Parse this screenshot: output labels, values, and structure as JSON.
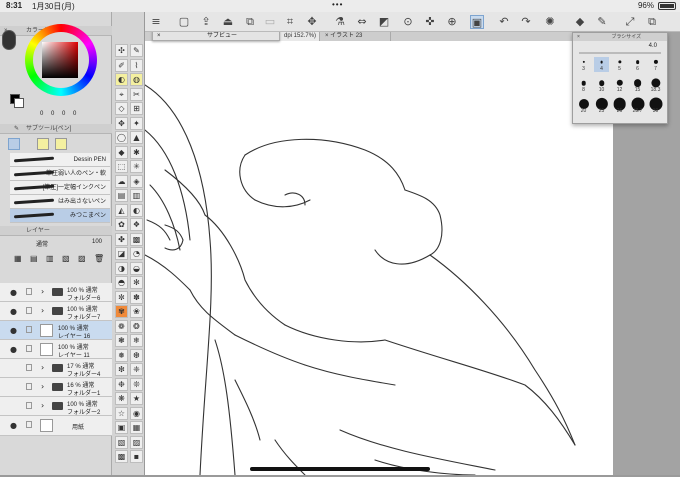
{
  "status_bar": {
    "time": "8:31",
    "date": "1月30日(月)",
    "dots": "•••",
    "battery": "96%"
  },
  "colors": {
    "accent": "#7ea4cf",
    "selected_row": "#c9dbef",
    "panel_bg": "#d9d9d9",
    "canvas_bg": "#ffffff"
  },
  "color_panel": {
    "title": "カラーサークル",
    "values": "0  0  0  0"
  },
  "subtool_panel": {
    "title": "サブツール[ペン]",
    "items": [
      {
        "label": "Dessin PEN"
      },
      {
        "label": "筆圧弱い人のペン・軟"
      },
      {
        "label": "[筆圧]一定幅インクペン"
      },
      {
        "label": "はみ出さないペン"
      },
      {
        "label": "みつこまペン"
      }
    ]
  },
  "layer_panel": {
    "title": "レイヤー",
    "blend_mode": "通常",
    "opacity": "100",
    "layers": [
      {
        "line1": "100 %  通常",
        "line2": "フォルダー6",
        "type": "folder"
      },
      {
        "line1": "100 %  通常",
        "line2": "フォルダー7",
        "type": "folder"
      },
      {
        "line1": "100 %  通常",
        "line2": "レイヤー 16",
        "type": "raster"
      },
      {
        "line1": "100 %  通常",
        "line2": "レイヤー 11",
        "type": "raster"
      },
      {
        "line1": "17 %  通常",
        "line2": "フォルダー4",
        "type": "folder"
      },
      {
        "line1": "16 %  通常",
        "line2": "フォルダー1",
        "type": "folder"
      },
      {
        "line1": "100 %  通常",
        "line2": "フォルダー2",
        "type": "folder"
      },
      {
        "line1": "",
        "line2": "用紙",
        "type": "paper"
      }
    ]
  },
  "canvas_tabs": [
    {
      "label": "dpi 152.7%)"
    },
    {
      "label": "イラスト 23"
    }
  ],
  "subview": {
    "title": "サブビュー"
  },
  "brush_size": {
    "title": "ブラシサイズ",
    "current": "4.0",
    "sizes": [
      "3",
      "4",
      "5",
      "6",
      "7",
      "8",
      "10",
      "12",
      "15",
      "18.3",
      "20",
      "25",
      "26",
      "28.7",
      "30"
    ]
  },
  "toolbar_icons": [
    "menu-icon",
    "new-icon",
    "export-icon",
    "save-icon",
    "copy-icon",
    "crop-icon",
    "move-icon",
    "flip-icon",
    "fill-icon",
    "zoom-icon",
    "transform-icon",
    "snap-icon",
    "grid-icon",
    "undo-icon",
    "redo-icon",
    "spinner-icon",
    "bucket-icon",
    "pen-icon",
    "resize-icon",
    "duplicate-icon"
  ]
}
